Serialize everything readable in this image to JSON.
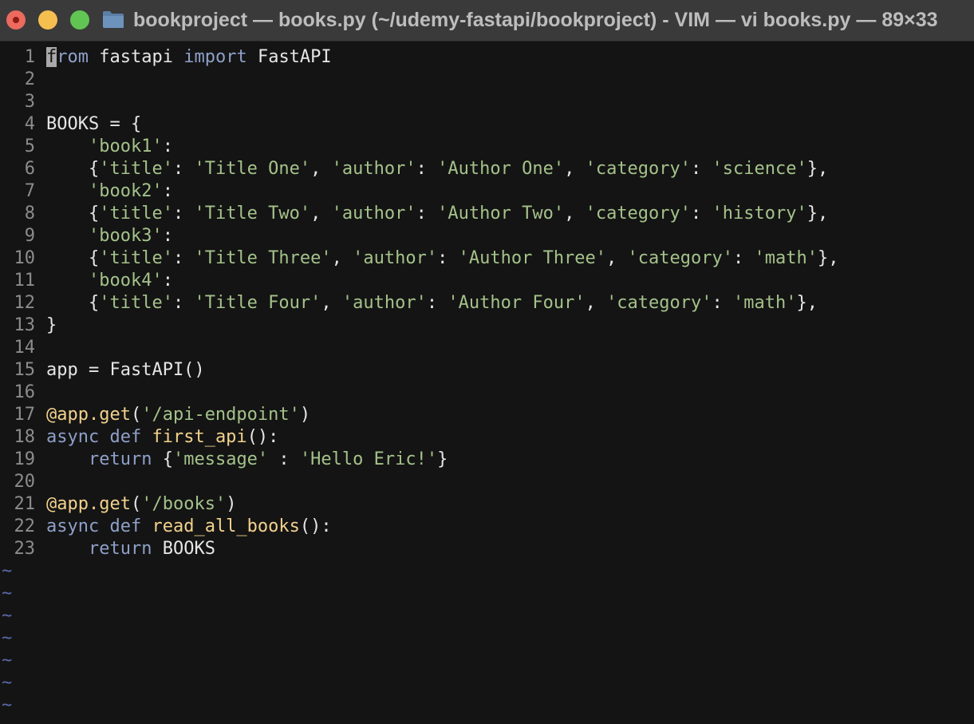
{
  "window": {
    "title": "bookproject — books.py (~/udemy-fastapi/bookproject) - VIM — vi books.py — 89×33"
  },
  "editor": {
    "lines": [
      {
        "num": "1",
        "tokens": [
          {
            "t": "f",
            "k": "cursor"
          },
          {
            "t": "rom",
            "k": "keyword"
          },
          {
            "t": " fastapi ",
            "k": "plain"
          },
          {
            "t": "import",
            "k": "keyword"
          },
          {
            "t": " FastAPI",
            "k": "plain"
          }
        ]
      },
      {
        "num": "2",
        "tokens": []
      },
      {
        "num": "3",
        "tokens": []
      },
      {
        "num": "4",
        "tokens": [
          {
            "t": "BOOKS = {",
            "k": "plain"
          }
        ]
      },
      {
        "num": "5",
        "tokens": [
          {
            "t": "    ",
            "k": "plain"
          },
          {
            "t": "'book1'",
            "k": "string"
          },
          {
            "t": ":",
            "k": "plain"
          }
        ]
      },
      {
        "num": "6",
        "tokens": [
          {
            "t": "    {",
            "k": "plain"
          },
          {
            "t": "'title'",
            "k": "string"
          },
          {
            "t": ": ",
            "k": "plain"
          },
          {
            "t": "'Title One'",
            "k": "string"
          },
          {
            "t": ", ",
            "k": "plain"
          },
          {
            "t": "'author'",
            "k": "string"
          },
          {
            "t": ": ",
            "k": "plain"
          },
          {
            "t": "'Author One'",
            "k": "string"
          },
          {
            "t": ", ",
            "k": "plain"
          },
          {
            "t": "'category'",
            "k": "string"
          },
          {
            "t": ": ",
            "k": "plain"
          },
          {
            "t": "'science'",
            "k": "string"
          },
          {
            "t": "},",
            "k": "plain"
          }
        ]
      },
      {
        "num": "7",
        "tokens": [
          {
            "t": "    ",
            "k": "plain"
          },
          {
            "t": "'book2'",
            "k": "string"
          },
          {
            "t": ":",
            "k": "plain"
          }
        ]
      },
      {
        "num": "8",
        "tokens": [
          {
            "t": "    {",
            "k": "plain"
          },
          {
            "t": "'title'",
            "k": "string"
          },
          {
            "t": ": ",
            "k": "plain"
          },
          {
            "t": "'Title Two'",
            "k": "string"
          },
          {
            "t": ", ",
            "k": "plain"
          },
          {
            "t": "'author'",
            "k": "string"
          },
          {
            "t": ": ",
            "k": "plain"
          },
          {
            "t": "'Author Two'",
            "k": "string"
          },
          {
            "t": ", ",
            "k": "plain"
          },
          {
            "t": "'category'",
            "k": "string"
          },
          {
            "t": ": ",
            "k": "plain"
          },
          {
            "t": "'history'",
            "k": "string"
          },
          {
            "t": "},",
            "k": "plain"
          }
        ]
      },
      {
        "num": "9",
        "tokens": [
          {
            "t": "    ",
            "k": "plain"
          },
          {
            "t": "'book3'",
            "k": "string"
          },
          {
            "t": ":",
            "k": "plain"
          }
        ]
      },
      {
        "num": "10",
        "tokens": [
          {
            "t": "    {",
            "k": "plain"
          },
          {
            "t": "'title'",
            "k": "string"
          },
          {
            "t": ": ",
            "k": "plain"
          },
          {
            "t": "'Title Three'",
            "k": "string"
          },
          {
            "t": ", ",
            "k": "plain"
          },
          {
            "t": "'author'",
            "k": "string"
          },
          {
            "t": ": ",
            "k": "plain"
          },
          {
            "t": "'Author Three'",
            "k": "string"
          },
          {
            "t": ", ",
            "k": "plain"
          },
          {
            "t": "'category'",
            "k": "string"
          },
          {
            "t": ": ",
            "k": "plain"
          },
          {
            "t": "'math'",
            "k": "string"
          },
          {
            "t": "},",
            "k": "plain"
          }
        ]
      },
      {
        "num": "11",
        "tokens": [
          {
            "t": "    ",
            "k": "plain"
          },
          {
            "t": "'book4'",
            "k": "string"
          },
          {
            "t": ":",
            "k": "plain"
          }
        ]
      },
      {
        "num": "12",
        "tokens": [
          {
            "t": "    {",
            "k": "plain"
          },
          {
            "t": "'title'",
            "k": "string"
          },
          {
            "t": ": ",
            "k": "plain"
          },
          {
            "t": "'Title Four'",
            "k": "string"
          },
          {
            "t": ", ",
            "k": "plain"
          },
          {
            "t": "'author'",
            "k": "string"
          },
          {
            "t": ": ",
            "k": "plain"
          },
          {
            "t": "'Author Four'",
            "k": "string"
          },
          {
            "t": ", ",
            "k": "plain"
          },
          {
            "t": "'category'",
            "k": "string"
          },
          {
            "t": ": ",
            "k": "plain"
          },
          {
            "t": "'math'",
            "k": "string"
          },
          {
            "t": "},",
            "k": "plain"
          }
        ]
      },
      {
        "num": "13",
        "tokens": [
          {
            "t": "}",
            "k": "plain"
          }
        ]
      },
      {
        "num": "14",
        "tokens": []
      },
      {
        "num": "15",
        "tokens": [
          {
            "t": "app = FastAPI()",
            "k": "plain"
          }
        ]
      },
      {
        "num": "16",
        "tokens": []
      },
      {
        "num": "17",
        "tokens": [
          {
            "t": "@app.get",
            "k": "func"
          },
          {
            "t": "(",
            "k": "plain"
          },
          {
            "t": "'/api-endpoint'",
            "k": "string"
          },
          {
            "t": ")",
            "k": "plain"
          }
        ]
      },
      {
        "num": "18",
        "tokens": [
          {
            "t": "async def",
            "k": "keyword"
          },
          {
            "t": " ",
            "k": "plain"
          },
          {
            "t": "first_api",
            "k": "func"
          },
          {
            "t": "():",
            "k": "plain"
          }
        ]
      },
      {
        "num": "19",
        "tokens": [
          {
            "t": "    ",
            "k": "plain"
          },
          {
            "t": "return",
            "k": "keyword"
          },
          {
            "t": " {",
            "k": "plain"
          },
          {
            "t": "'message'",
            "k": "string"
          },
          {
            "t": " : ",
            "k": "plain"
          },
          {
            "t": "'Hello Eric!'",
            "k": "string"
          },
          {
            "t": "}",
            "k": "plain"
          }
        ]
      },
      {
        "num": "20",
        "tokens": []
      },
      {
        "num": "21",
        "tokens": [
          {
            "t": "@app.get",
            "k": "func"
          },
          {
            "t": "(",
            "k": "plain"
          },
          {
            "t": "'/books'",
            "k": "string"
          },
          {
            "t": ")",
            "k": "plain"
          }
        ]
      },
      {
        "num": "22",
        "tokens": [
          {
            "t": "async def",
            "k": "keyword"
          },
          {
            "t": " ",
            "k": "plain"
          },
          {
            "t": "read_all_books",
            "k": "func"
          },
          {
            "t": "():",
            "k": "plain"
          }
        ]
      },
      {
        "num": "23",
        "tokens": [
          {
            "t": "    ",
            "k": "plain"
          },
          {
            "t": "return",
            "k": "keyword"
          },
          {
            "t": " BOOKS",
            "k": "plain"
          }
        ]
      }
    ],
    "empty_marker": "~",
    "empty_lines": 7
  },
  "colors": {
    "background": "#141414",
    "keyword": "#8ea0c9",
    "string": "#a4c28a",
    "function": "#f2d28d",
    "line_number": "#8c8c8c",
    "tilde": "#5a6aa8"
  },
  "icons": {
    "close": "close-traffic-light-icon",
    "minimize": "minimize-traffic-light-icon",
    "maximize": "maximize-traffic-light-icon",
    "folder": "folder-icon"
  }
}
